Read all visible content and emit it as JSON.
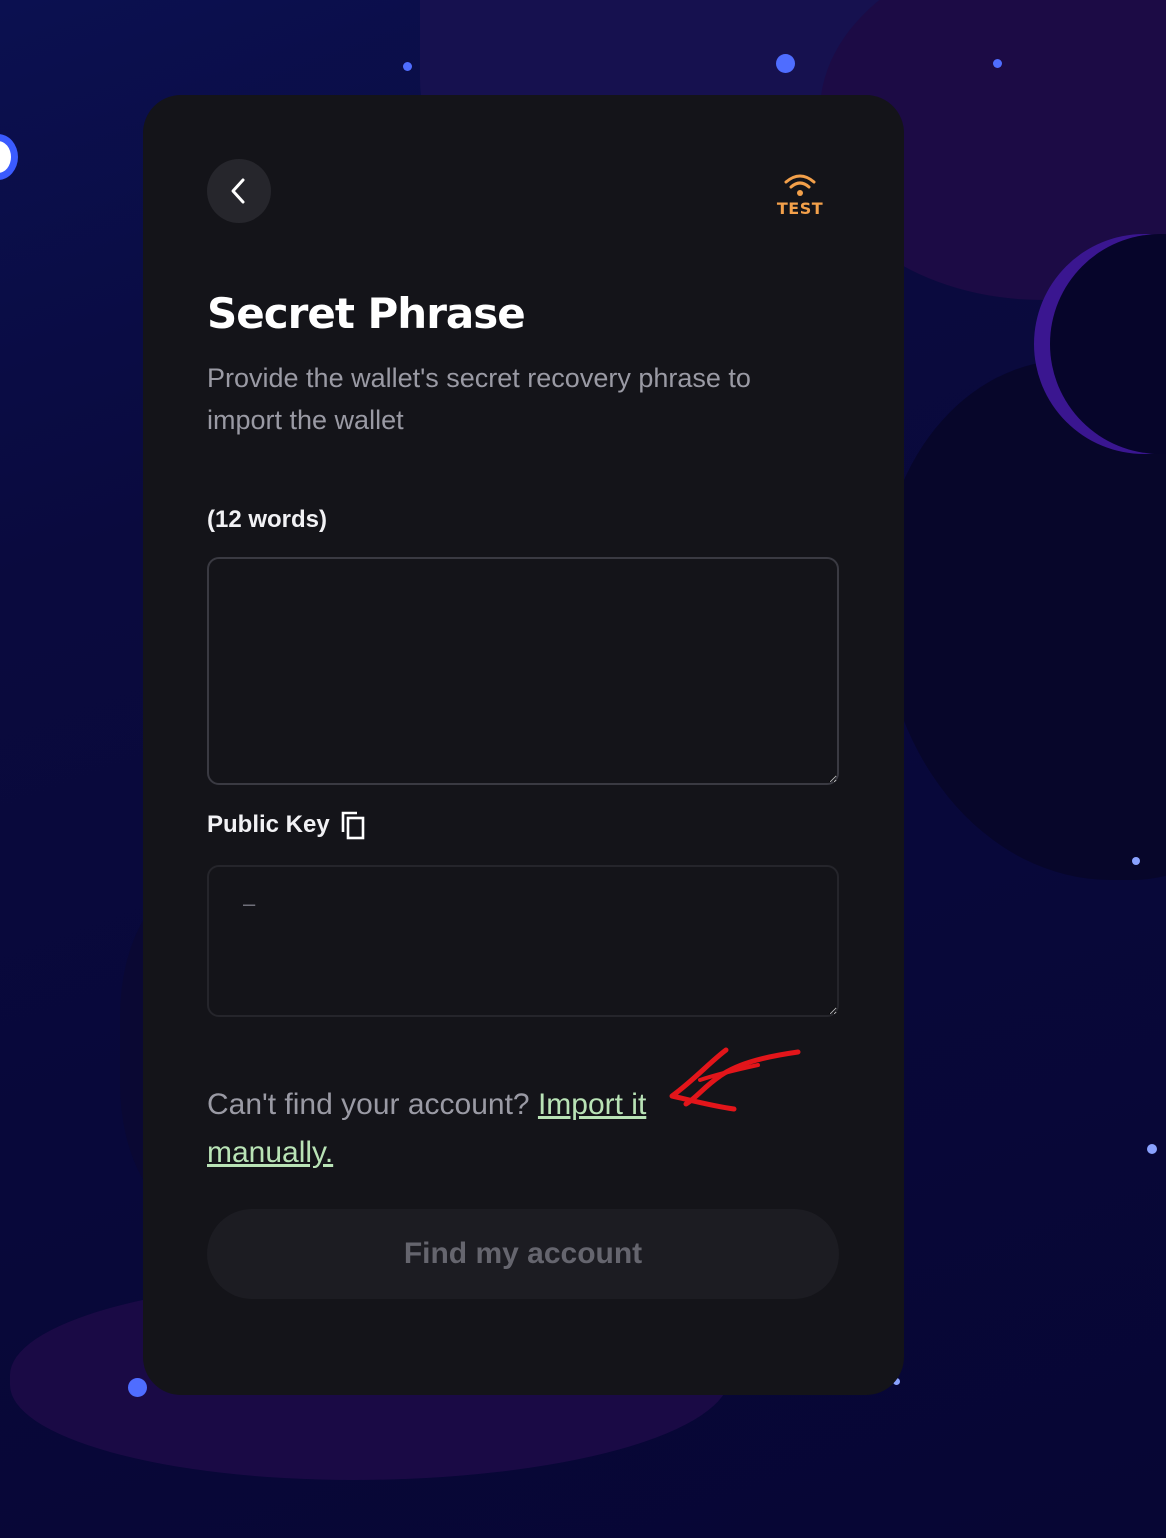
{
  "header": {
    "back_icon": "chevron-left-icon",
    "network_icon": "wifi-icon",
    "network_label": "TEST",
    "network_color": "#f3a04a"
  },
  "main": {
    "title": "Secret Phrase",
    "subtitle": "Provide the wallet's secret recovery phrase to import the wallet"
  },
  "phrase_field": {
    "label": "(12 words)",
    "value": ""
  },
  "public_key_field": {
    "label": "Public Key",
    "copy_icon": "copy-icon",
    "value": "–"
  },
  "import_prompt": {
    "text": "Can't find your account? ",
    "link_label": "Import it manually.",
    "link_color": "#b9e3b6"
  },
  "actions": {
    "find_label": "Find my account"
  },
  "colors": {
    "card_background": "#141419",
    "annotation": "#e3151a"
  }
}
